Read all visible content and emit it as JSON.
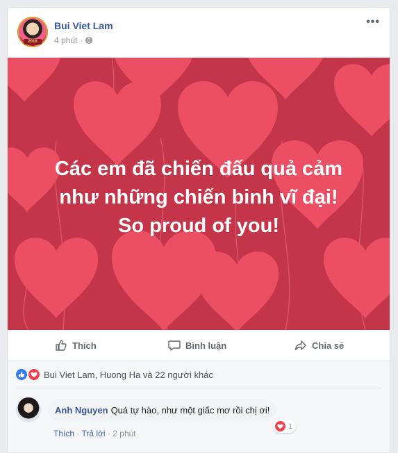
{
  "post": {
    "author": "Bui Viet Lam",
    "time": "4 phút",
    "separator": "·",
    "privacy_icon": "globe-icon",
    "more_icon": "ellipsis-icon",
    "avatar_badge": "2018"
  },
  "image": {
    "background": "#c43549",
    "heart_color": "#ec4f63",
    "caption_lines": [
      "Các em đã chiến đấu quả cảm",
      "như những chiến binh vĩ đại!",
      "So proud of you!"
    ]
  },
  "actions": {
    "like": "Thích",
    "comment": "Bình luận",
    "share": "Chia sẻ"
  },
  "reactions": {
    "icons": [
      "like-icon",
      "love-icon"
    ],
    "summary": "Bui Viet Lam, Huong Ha và 22 người khác"
  },
  "comment": {
    "author": "Anh Nguyen",
    "text": "Quá tự hào, như một giấc mơ rồi chị ơi!",
    "reaction_count": "1",
    "like": "Thích",
    "reply": "Trả lời",
    "time": "2 phút",
    "sep": "·"
  },
  "colors": {
    "link": "#365899",
    "meta": "#90949c",
    "like_blue": "#2e7bf6",
    "love_red": "#f0404e"
  }
}
